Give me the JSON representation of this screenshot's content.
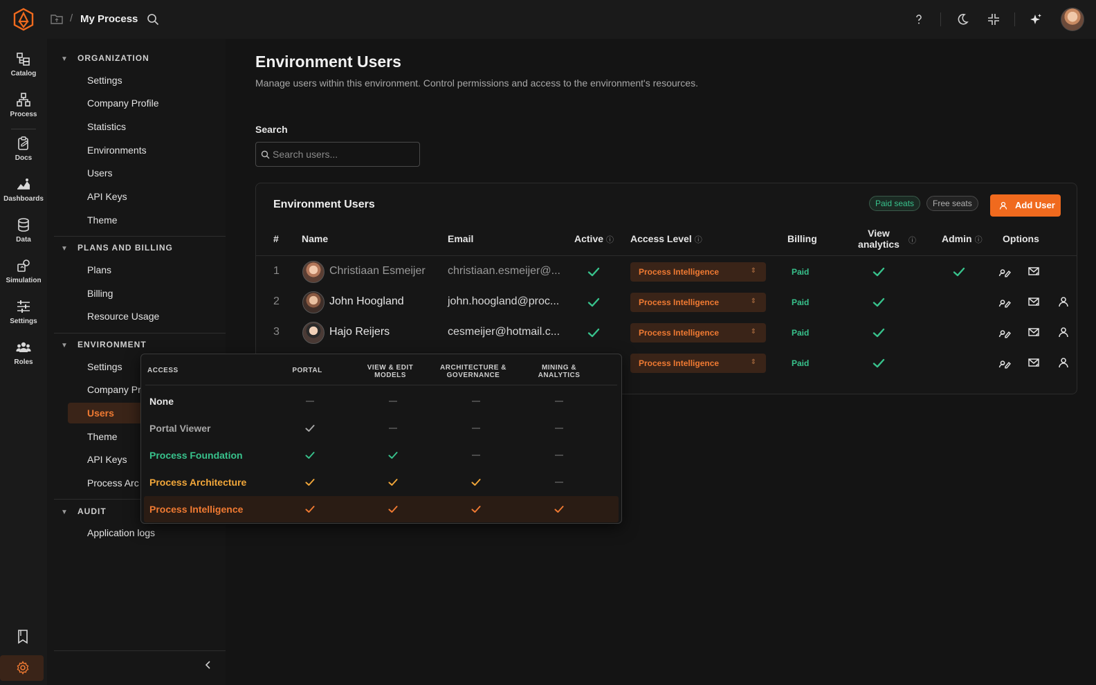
{
  "topbar": {
    "breadcrumb_sep": "/",
    "title": "My Process"
  },
  "rail": {
    "items": [
      {
        "label": "Catalog",
        "icon": "catalog-icon"
      },
      {
        "label": "Process",
        "icon": "process-icon"
      },
      {
        "label": "Docs",
        "icon": "docs-icon"
      },
      {
        "label": "Dashboards",
        "icon": "dashboards-icon"
      },
      {
        "label": "Data",
        "icon": "data-icon"
      },
      {
        "label": "Simulation",
        "icon": "simulation-icon"
      },
      {
        "label": "Settings",
        "icon": "settings-sliders-icon"
      },
      {
        "label": "Roles",
        "icon": "roles-icon"
      }
    ]
  },
  "sidebar": {
    "organization": {
      "heading": "ORGANIZATION",
      "items": [
        "Settings",
        "Company Profile",
        "Statistics",
        "Environments",
        "Users",
        "API Keys",
        "Theme"
      ]
    },
    "plans": {
      "heading": "PLANS AND BILLING",
      "items": [
        "Plans",
        "Billing",
        "Resource Usage"
      ]
    },
    "environment": {
      "heading": "ENVIRONMENT",
      "items": [
        "Settings",
        "Company Pr",
        "Users",
        "Theme",
        "API Keys",
        "Process Arc"
      ],
      "active": "Users"
    },
    "audit": {
      "heading": "AUDIT",
      "items": [
        "Application logs"
      ]
    }
  },
  "main": {
    "title": "Environment Users",
    "subtitle": "Manage users within this environment. Control permissions and access to the environment's resources.",
    "search_label": "Search",
    "search_placeholder": "Search users..."
  },
  "card": {
    "title": "Environment Users",
    "paid_seats": "Paid seats",
    "free_seats": "Free seats",
    "add_user": "Add User",
    "columns": {
      "num": "#",
      "name": "Name",
      "email": "Email",
      "active": "Active",
      "access": "Access Level",
      "billing": "Billing",
      "view": "View analytics",
      "admin": "Admin",
      "options": "Options"
    },
    "info_glyph": "ⓘ",
    "rows": [
      {
        "num": "1",
        "name": "Christiaan Esmeijer",
        "email": "christiaan.esmeijer@...",
        "access": "Process Intelligence",
        "billing": "Paid",
        "active": true,
        "view": true,
        "admin": true
      },
      {
        "num": "2",
        "name": "John Hoogland",
        "email": "john.hoogland@proc...",
        "access": "Process Intelligence",
        "billing": "Paid",
        "active": true,
        "view": true,
        "admin": false
      },
      {
        "num": "3",
        "name": "Hajo Reijers",
        "email": "cesmeijer@hotmail.c...",
        "access": "Process Intelligence",
        "billing": "Paid",
        "active": true,
        "view": true,
        "admin": false
      },
      {
        "num": "",
        "name": "",
        "email": "",
        "access": "Process Intelligence",
        "billing": "Paid",
        "active": false,
        "view": true,
        "admin": false
      }
    ]
  },
  "popover": {
    "headers": {
      "access": "ACCESS",
      "portal": "PORTAL",
      "view_edit_1": "VIEW & EDIT",
      "view_edit_2": "MODELS",
      "arch_1": "ARCHITECTURE &",
      "arch_2": "GOVERNANCE",
      "mining_1": "MINING &",
      "mining_2": "ANALYTICS"
    },
    "levels": [
      {
        "name": "None",
        "color": "#e6e6e6",
        "grants": [
          false,
          false,
          false,
          false
        ]
      },
      {
        "name": "Portal Viewer",
        "color": "#a8a8a8",
        "grants": [
          true,
          false,
          false,
          false
        ]
      },
      {
        "name": "Process Foundation",
        "color": "#38c28c",
        "grants": [
          true,
          true,
          false,
          false
        ]
      },
      {
        "name": "Process Architecture",
        "color": "#f2a73a",
        "grants": [
          true,
          true,
          true,
          false
        ]
      },
      {
        "name": "Process Intelligence",
        "color": "#f07a32",
        "grants": [
          true,
          true,
          true,
          true
        ],
        "selected": true
      }
    ]
  },
  "colors": {
    "accent": "#f06a1e",
    "success": "#38c28c"
  }
}
